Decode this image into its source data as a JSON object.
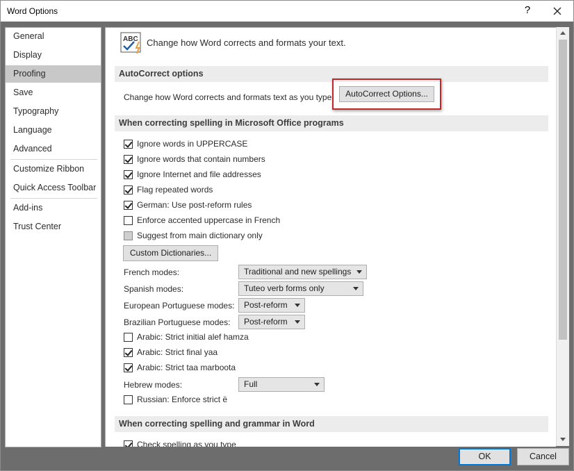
{
  "window": {
    "title": "Word Options",
    "help_label": "?",
    "close_icon": "close-icon"
  },
  "sidebar": {
    "items": [
      {
        "label": "General",
        "active": false
      },
      {
        "label": "Display",
        "active": false
      },
      {
        "label": "Proofing",
        "active": true
      },
      {
        "label": "Save",
        "active": false
      },
      {
        "label": "Typography",
        "active": false
      },
      {
        "label": "Language",
        "active": false
      },
      {
        "label": "Advanced",
        "active": false
      },
      {
        "label": "Customize Ribbon",
        "active": false
      },
      {
        "label": "Quick Access Toolbar",
        "active": false
      },
      {
        "label": "Add-ins",
        "active": false
      },
      {
        "label": "Trust Center",
        "active": false
      }
    ]
  },
  "header": {
    "icon": "abc-check-icon",
    "text": "Change how Word corrects and formats your text."
  },
  "autocorrect": {
    "section_title": "AutoCorrect options",
    "description": "Change how Word corrects and formats text as you type:",
    "button_label": "AutoCorrect Options..."
  },
  "spelling": {
    "section_title": "When correcting spelling in Microsoft Office programs",
    "checkboxes": [
      {
        "label": "Ignore words in UPPERCASE",
        "checked": true
      },
      {
        "label": "Ignore words that contain numbers",
        "checked": true
      },
      {
        "label": "Ignore Internet and file addresses",
        "checked": true
      },
      {
        "label": "Flag repeated words",
        "checked": true
      },
      {
        "label": "German: Use post-reform rules",
        "checked": true
      },
      {
        "label": "Enforce accented uppercase in French",
        "checked": false
      },
      {
        "label": "Suggest from main dictionary only",
        "checked": false,
        "disabled": true
      }
    ],
    "custom_dict_label": "Custom Dictionaries...",
    "modes": [
      {
        "label": "French modes:",
        "value": "Traditional and new spellings"
      },
      {
        "label": "Spanish modes:",
        "value": "Tuteo verb forms only"
      },
      {
        "label": "European Portuguese modes:",
        "value": "Post-reform"
      },
      {
        "label": "Brazilian Portuguese modes:",
        "value": "Post-reform"
      }
    ],
    "arabic": [
      {
        "label": "Arabic: Strict initial alef hamza",
        "checked": false
      },
      {
        "label": "Arabic: Strict final yaa",
        "checked": true
      },
      {
        "label": "Arabic: Strict taa marboota",
        "checked": true
      }
    ],
    "hebrew": {
      "label": "Hebrew modes:",
      "value": "Full"
    },
    "russian": {
      "label": "Russian: Enforce strict ë",
      "checked": false
    }
  },
  "grammar": {
    "section_title": "When correcting spelling and grammar in Word",
    "first_checkbox": {
      "label": "Check spelling as you type",
      "checked": true
    }
  },
  "footer": {
    "ok_label": "OK",
    "cancel_label": "Cancel"
  },
  "colors": {
    "highlight": "#c0272d",
    "active_nav": "#c8c8c8",
    "section_bg": "#ececec",
    "chrome": "#6d6d6d"
  }
}
